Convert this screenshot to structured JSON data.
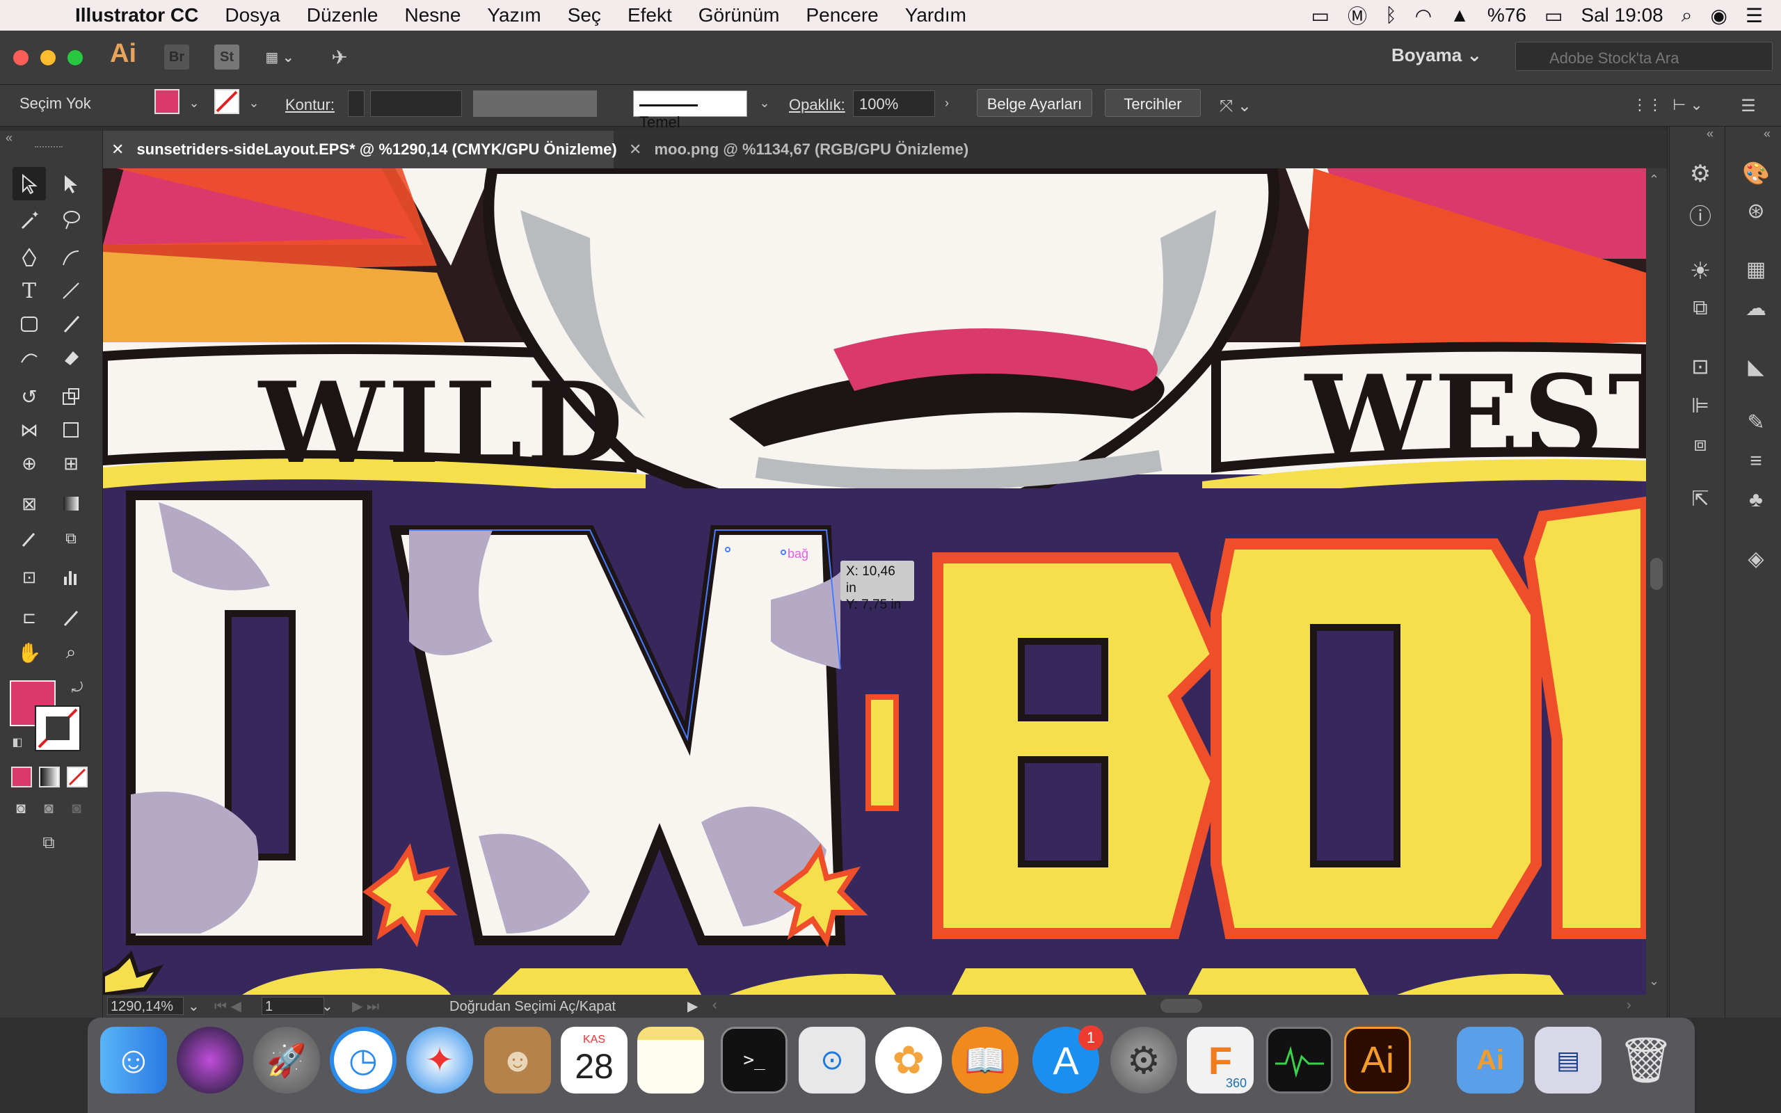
{
  "menubar": {
    "app_name": "Illustrator CC",
    "items": [
      "Dosya",
      "Düzenle",
      "Nesne",
      "Yazım",
      "Seç",
      "Efekt",
      "Görünüm",
      "Pencere",
      "Yardım"
    ],
    "battery": "%76",
    "clock": "Sal 19:08"
  },
  "appbar": {
    "logo": "Ai",
    "bridge": "Br",
    "stock_btn": "St",
    "workspace": "Boyama",
    "search_placeholder": "Adobe Stock'ta Ara"
  },
  "control": {
    "selection": "Seçim Yok",
    "stroke_label": "Kontur:",
    "brush": "Temel",
    "opacity_label": "Opaklık:",
    "opacity_value": "100%",
    "doc_settings": "Belge Ayarları",
    "preferences": "Tercihler"
  },
  "tabs": [
    {
      "label": "sunsetriders-sideLayout.EPS* @ %1290,14 (CMYK/GPU Önizleme)",
      "active": true
    },
    {
      "label": "moo.png @ %1134,67 (RGB/GPU Önizleme)",
      "active": false
    }
  ],
  "canvas": {
    "artwork_text_top_left": "WILD",
    "artwork_text_top_right": "WEST",
    "artwork_letters_left": "OW",
    "artwork_letters_right": "BOY",
    "anchor_hint": "bağ",
    "readout_x": "X: 10,46 in",
    "readout_y": "Y: 7,75 in"
  },
  "status": {
    "zoom": "1290,14%",
    "artboard": "1",
    "message": "Doğrudan Seçimi Aç/Kapat"
  },
  "dock": {
    "calendar_month": "KAS",
    "calendar_day": "28",
    "appstore_badge": "1",
    "fusion_label": "360",
    "ai_label": "Ai"
  },
  "colors": {
    "fill": "#d93a6b",
    "canvas_bg": "#36285c",
    "yellow": "#f5df4d",
    "orange": "#ee4f2a",
    "magenta": "#d93a6b"
  }
}
